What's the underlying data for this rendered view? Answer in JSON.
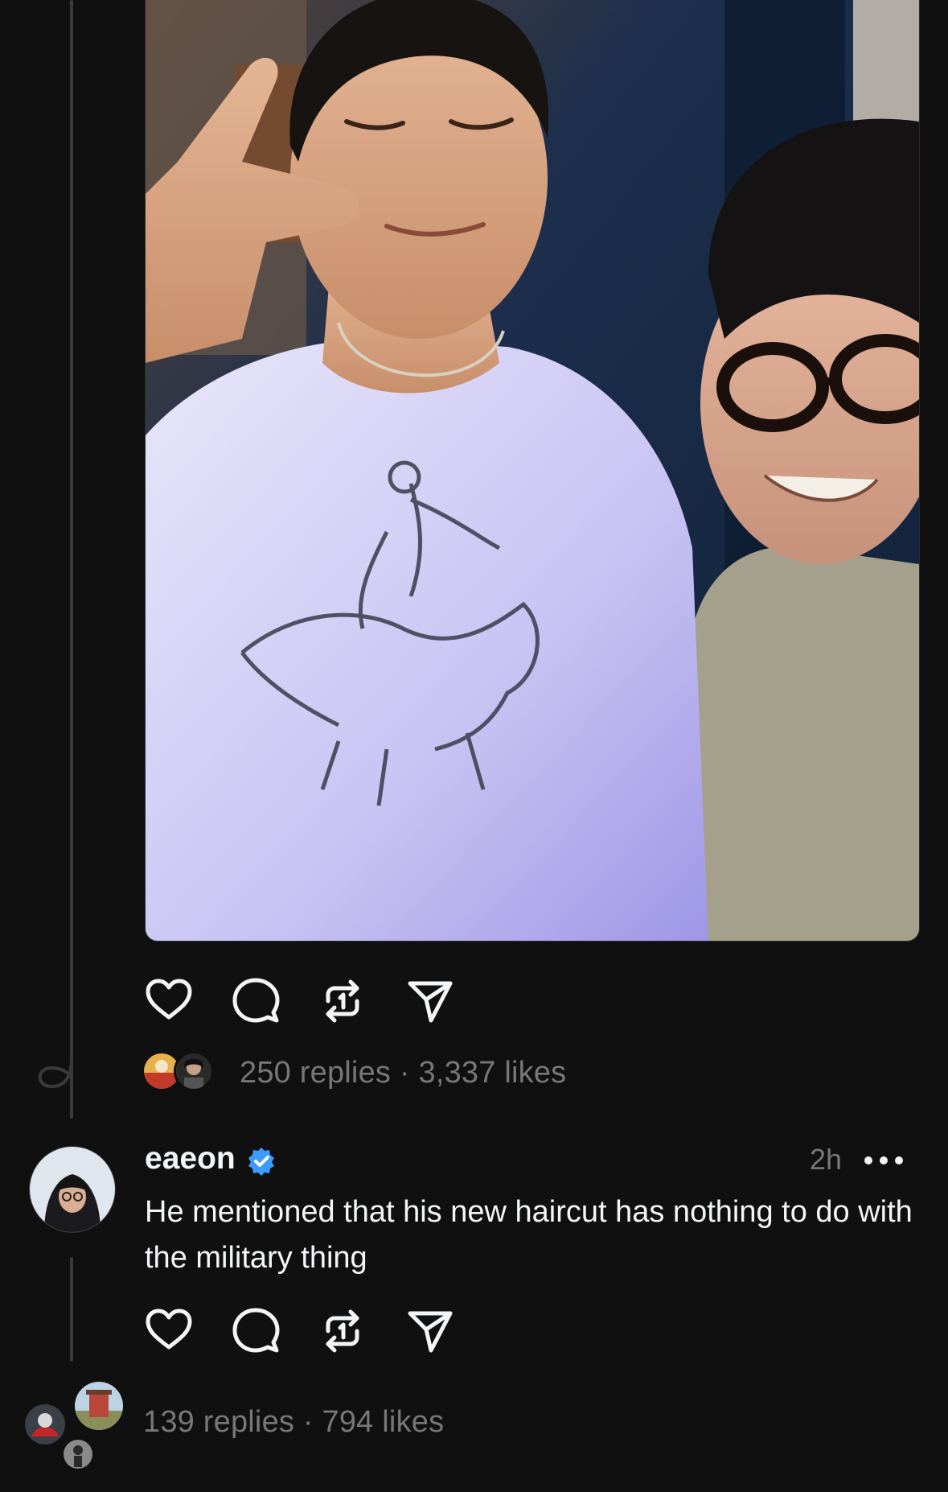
{
  "post": {
    "photo_alt": "",
    "stats": {
      "replies": "250 replies",
      "separator": "·",
      "likes": "3,337 likes"
    }
  },
  "reply": {
    "username": "eaeon",
    "verified": true,
    "time": "2h",
    "text": "He mentioned that his new haircut has nothing to do with the military thing",
    "stats": {
      "replies": "139 replies",
      "separator": "·",
      "likes": "794 likes"
    }
  },
  "icons": {
    "like": "heart-icon",
    "reply": "comment-icon",
    "repost": "repost-icon",
    "share": "send-icon",
    "more": "more-icon",
    "verified": "verified-badge-icon"
  },
  "colors": {
    "background": "#101010",
    "text": "#f3f5f7",
    "muted": "#777777",
    "verified": "#3c9bff",
    "thread_line": "#3a3a3a"
  }
}
